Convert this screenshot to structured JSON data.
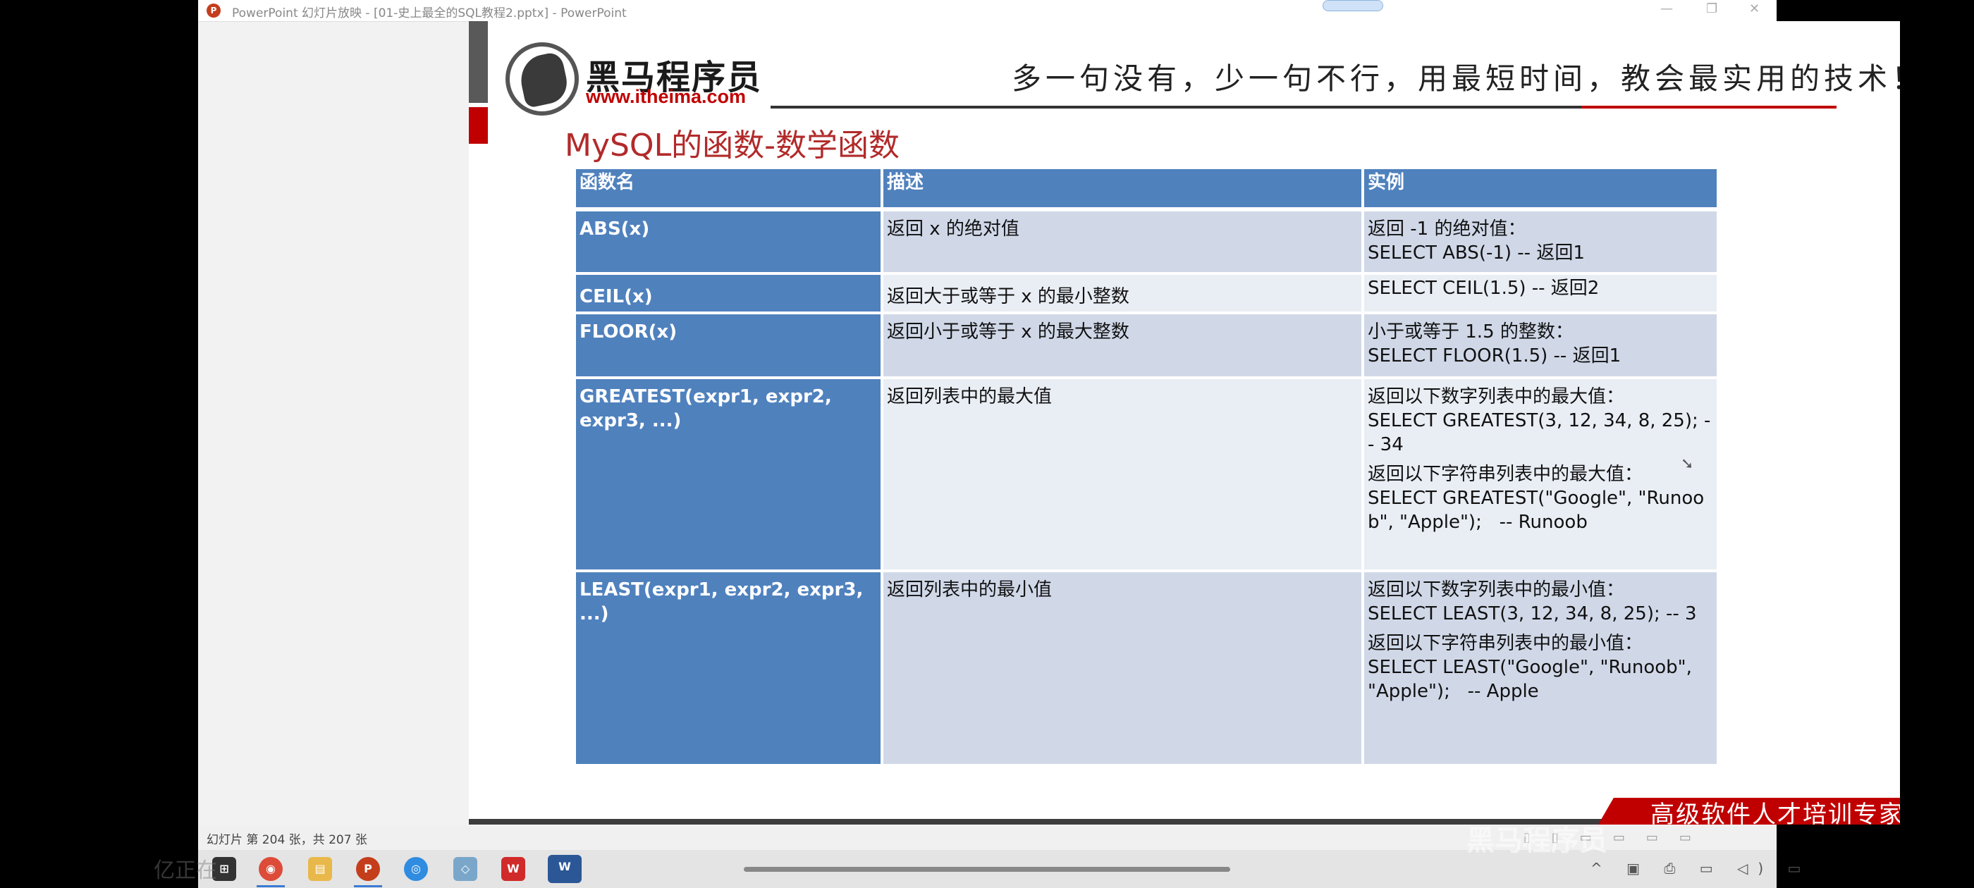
{
  "window": {
    "title": "PowerPoint 幻灯片放映 - [01-史上最全的SQL教程2.pptx] - PowerPoint",
    "app_icon": "powerpoint-icon",
    "controls": {
      "minimize": "—",
      "restore": "❐",
      "close": "✕"
    }
  },
  "slide": {
    "logo_name": "黑马程序员",
    "logo_url": "www.itheima.com",
    "slogan": "多一句没有，少一句不行，用最短时间，教会最实用的技术！",
    "title": "MySQL的函数-数学函数",
    "footer_banner": "高级软件人才培训专家",
    "table": {
      "headers": [
        "函数名",
        "描述",
        "实例"
      ],
      "rows": [
        {
          "name": "ABS(x)",
          "desc": "返回 x 的绝对值",
          "example": [
            "返回 -1 的绝对值：",
            "SELECT ABS(-1) -- 返回1"
          ]
        },
        {
          "name": "CEIL(x)",
          "desc": "返回大于或等于 x 的最小整数",
          "example": [
            "SELECT CEIL(1.5) -- 返回2"
          ]
        },
        {
          "name": "FLOOR(x)",
          "desc": "返回小于或等于 x 的最大整数",
          "example": [
            "小于或等于 1.5 的整数：",
            "SELECT FLOOR(1.5) -- 返回1"
          ]
        },
        {
          "name": "GREATEST(expr1, expr2, expr3, ...)",
          "desc": "返回列表中的最大值",
          "example": [
            "返回以下数字列表中的最大值：",
            "SELECT GREATEST(3, 12, 34, 8, 25); -- 34",
            "返回以下字符串列表中的最大值：",
            "SELECT GREATEST(\"Google\", \"Runoob\", \"Apple\");   -- Runoob"
          ]
        },
        {
          "name": "LEAST(expr1, expr2, expr3, ...)",
          "desc": "返回列表中的最小值",
          "example": [
            "返回以下数字列表中的最小值：",
            "SELECT LEAST(3, 12, 34, 8, 25); -- 3",
            "返回以下字符串列表中的最小值：",
            "SELECT LEAST(\"Google\", \"Runoob\", \"Apple\");   -- Apple"
          ]
        }
      ]
    }
  },
  "status_bar": {
    "slide_counter": "幻灯片 第 204 张，共 207 张"
  },
  "overlay": {
    "watermark": "黑马程序员",
    "ghost_text": "亿正在"
  },
  "taskbar": {
    "icons": [
      "windows-start-icon",
      "chrome-icon",
      "file-explorer-icon",
      "powerpoint-icon",
      "browser-icon",
      "app-icon",
      "wps-icon",
      "word-icon"
    ],
    "tray": "^ ▣ ⎙ ▭ ◁) ▭"
  }
}
